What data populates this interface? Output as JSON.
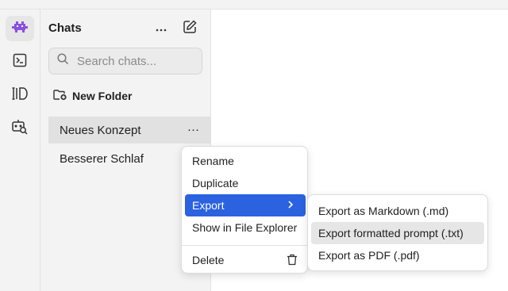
{
  "rail": {
    "items": [
      {
        "icon": "alien-logo-icon"
      },
      {
        "icon": "terminal-icon"
      },
      {
        "icon": "library-icon"
      },
      {
        "icon": "bot-search-icon"
      }
    ]
  },
  "sidebar": {
    "title": "Chats",
    "search_placeholder": "Search chats...",
    "new_folder_label": "New Folder",
    "chats": [
      {
        "label": "Neues Konzept",
        "more": "···"
      },
      {
        "label": "Besserer Schlaf"
      }
    ]
  },
  "context_menu": {
    "items": [
      "Rename",
      "Duplicate",
      "Export",
      "Show in File Explorer",
      "Delete"
    ],
    "highlighted": "Export"
  },
  "export_submenu": {
    "items": [
      "Export as Markdown (.md)",
      "Export formatted prompt (.txt)",
      "Export as PDF (.pdf)"
    ],
    "hovered": "Export formatted prompt (.txt)"
  },
  "colors": {
    "accent": "#2a62e0",
    "logo": "#8b4fe0"
  }
}
